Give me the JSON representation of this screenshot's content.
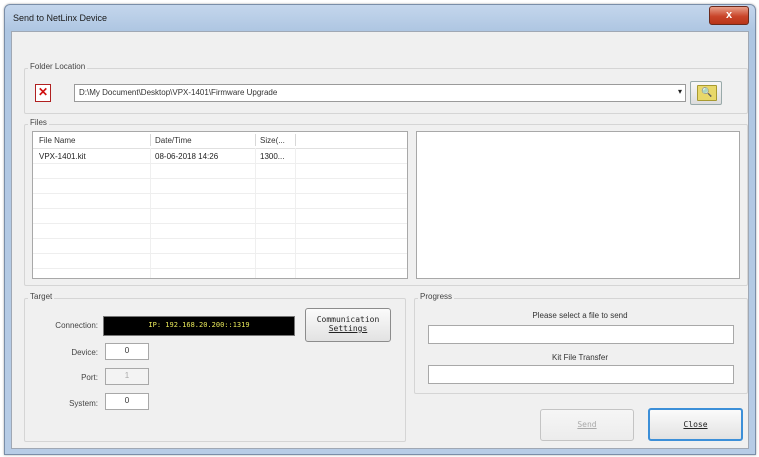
{
  "window": {
    "title": "Send to NetLinx Device",
    "close_symbol": "x"
  },
  "folder": {
    "group_label": "Folder Location",
    "doc_icon": "pdf-doc-icon",
    "path": "D:\\My Document\\Desktop\\VPX-1401\\Firmware Upgrade",
    "dropdown_arrow": "▾",
    "browse_icon": "folder-browse-icon"
  },
  "files": {
    "group_label": "Files",
    "columns": [
      "File Name",
      "Date/Time",
      "Size(..."
    ],
    "rows": [
      {
        "name": "VPX-1401.kit",
        "datetime": "08-06-2018  14:26",
        "size": "1300..."
      }
    ]
  },
  "target": {
    "group_label": "Target",
    "connection_label": "Connection:",
    "connection_value": "IP: 192.168.20.200::1319",
    "comm_button": [
      "Communication",
      "Settings"
    ],
    "device_label": "Device:",
    "device_value": "0",
    "port_label": "Port:",
    "port_value": "1",
    "system_label": "System:",
    "system_value": "0"
  },
  "progress": {
    "group_label": "Progress",
    "status_text": "Please select a file to send",
    "transfer_label": "Kit File Transfer"
  },
  "buttons": {
    "send": "Send",
    "close": "Close"
  }
}
